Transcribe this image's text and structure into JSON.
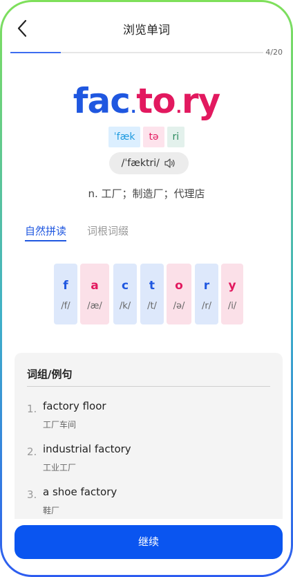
{
  "header": {
    "title": "浏览单词",
    "back_icon": "chevron-left-icon"
  },
  "progress": {
    "text": "4/20",
    "current": 4,
    "total": 20,
    "fraction": 0.2
  },
  "word": {
    "segments": [
      {
        "text": "fac",
        "color": "#1f57e0"
      },
      {
        "text": "to",
        "color": "#e2195f"
      },
      {
        "text": "ry",
        "color": "#e2195f"
      }
    ],
    "dot_colors": [
      "#1f57e0",
      "#e2195f"
    ]
  },
  "syllables": [
    {
      "text": "ˈfæk",
      "bg": "#dcefff",
      "color": "#1f9be0"
    },
    {
      "text": "tə",
      "bg": "#fde3ec",
      "color": "#e2195f"
    },
    {
      "text": "ri",
      "bg": "#e3f1ec",
      "color": "#2a8a5c"
    }
  ],
  "phonetic": {
    "text": "/ˈfæktri/",
    "icon": "speaker-icon"
  },
  "meaning": "n. 工厂；制造厂；代理店",
  "tabs": [
    {
      "label": "自然拼读",
      "active": true
    },
    {
      "label": "词根词缀",
      "active": false
    }
  ],
  "letters": [
    {
      "ch": "f",
      "ph": "/f/",
      "bg": "#dde8fb",
      "color": "#1f57e0"
    },
    {
      "ch": "a",
      "ph": "/æ/",
      "bg": "#fbe0e8",
      "color": "#e2195f"
    },
    {
      "ch": "c",
      "ph": "/k/",
      "bg": "#dde8fb",
      "color": "#1f57e0"
    },
    {
      "ch": "t",
      "ph": "/t/",
      "bg": "#dde8fb",
      "color": "#1f57e0"
    },
    {
      "ch": "o",
      "ph": "/ə/",
      "bg": "#fbe0e8",
      "color": "#e2195f"
    },
    {
      "ch": "r",
      "ph": "/r/",
      "bg": "#dde8fb",
      "color": "#1f57e0"
    },
    {
      "ch": "y",
      "ph": "/i/",
      "bg": "#fbe0e8",
      "color": "#e2195f"
    }
  ],
  "phrases": {
    "title": "词组/例句",
    "items": [
      {
        "num": "1.",
        "en": "factory floor",
        "cn": "工厂车间"
      },
      {
        "num": "2.",
        "en": "industrial factory",
        "cn": "工业工厂"
      },
      {
        "num": "3.",
        "en": "a shoe factory",
        "cn": "鞋厂"
      }
    ]
  },
  "continue_label": "继续"
}
